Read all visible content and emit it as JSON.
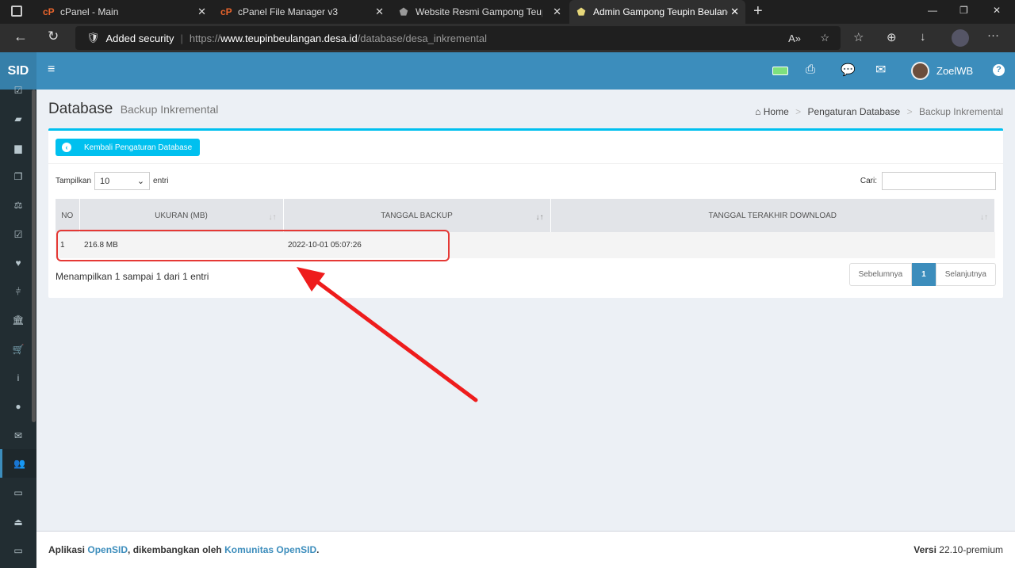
{
  "browser": {
    "tabs": [
      {
        "label": "cPanel - Main"
      },
      {
        "label": "cPanel File Manager v3"
      },
      {
        "label": "Website Resmi Gampong Teupin"
      },
      {
        "label": "Admin Gampong Teupin Beulang"
      }
    ],
    "security_label": "Added security",
    "url_prefix": "https://",
    "url_domain": "www.teupinbeulangan.desa.id",
    "url_path": "/database/desa_inkremental"
  },
  "header": {
    "logo": "SID",
    "user": "ZoelWB"
  },
  "sidebar": {
    "icons": [
      "checkbox-icon",
      "book-icon",
      "archive-icon",
      "copy-icon",
      "balance-scale-icon",
      "check-square-icon",
      "heart-icon",
      "signpost-icon",
      "bank-icon",
      "cart-icon",
      "info-icon",
      "globe-icon",
      "envelope-icon",
      "users-icon",
      "desktop-icon",
      "inbox-icon",
      "monitor-icon"
    ],
    "active_index": 13
  },
  "page": {
    "title": "Database",
    "subtitle": "Backup Inkremental",
    "breadcrumb": [
      "Home",
      "Pengaturan Database",
      "Backup Inkremental"
    ]
  },
  "box": {
    "back_button": "Kembali Pengaturan Database",
    "show_label": "Tampilkan",
    "show_value": "10",
    "entries_label": "entri",
    "search_label": "Cari:",
    "search_value": "",
    "columns": [
      "NO",
      "UKURAN (MB)",
      "TANGGAL BACKUP",
      "TANGGAL TERAKHIR DOWNLOAD"
    ],
    "rows": [
      {
        "no": "1",
        "size": "216.8 MB",
        "backup_date": "2022-10-01 05:07:26",
        "last_download": ""
      }
    ],
    "info": "Menampilkan 1 sampai 1 dari 1 entri",
    "pagination": {
      "prev": "Sebelumnya",
      "current": "1",
      "next": "Selanjutnya"
    }
  },
  "footer": {
    "app": "Aplikasi",
    "opensid": "OpenSID",
    "developed": ", dikembangkan oleh",
    "community": "Komunitas OpenSID",
    "end": ".",
    "version_label": "Versi",
    "version": "22.10-premium"
  },
  "colors": {
    "header": "#3c8dbc",
    "sidebar": "#222d32",
    "accent": "#00c0ef",
    "highlight": "#e53935"
  }
}
